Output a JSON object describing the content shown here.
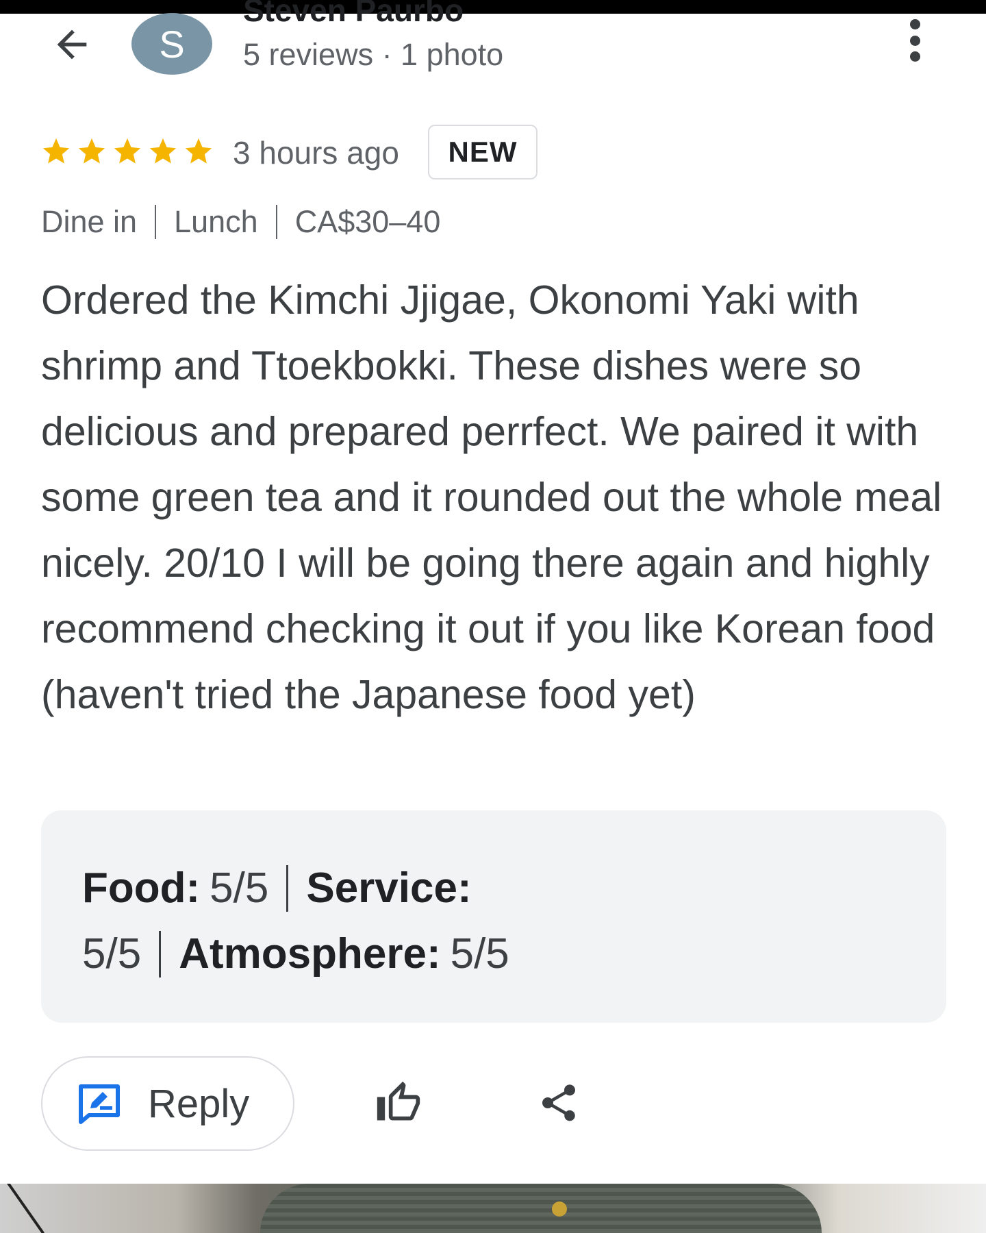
{
  "header": {
    "reviewer_name": "Steven Paurbo",
    "avatar_initial": "S",
    "meta": "5 reviews · 1 photo"
  },
  "review": {
    "rating": 5,
    "rating_max": 5,
    "time": "3 hours ago",
    "badge": "NEW",
    "tags": [
      "Dine in",
      "Lunch",
      "CA$30–40"
    ],
    "text": "Ordered the Kimchi Jjigae, Okonomi Yaki with shrimp and Ttoekbokki. These dishes were so delicious and prepared perrfect. We paired it with some green tea and it rounded out the whole meal nicely. 20/10 I will be going there again and highly recommend checking it out if you like Korean food (haven't tried the Japanese food yet)"
  },
  "subratings": {
    "food_label": "Food:",
    "food_value": "5/5",
    "service_label": "Service:",
    "service_value": "5/5",
    "atmosphere_label": "Atmosphere:",
    "atmosphere_value": "5/5"
  },
  "actions": {
    "reply_label": "Reply"
  },
  "icons": {
    "back": "arrow-back-icon",
    "more": "more-vert-icon",
    "star": "star-icon",
    "reply": "reply-edit-icon",
    "like": "thumb-up-icon",
    "share": "share-icon"
  },
  "colors": {
    "star": "#f4b400",
    "reply_icon": "#1a73e8",
    "avatar_bg": "#7a96a6",
    "subrating_bg": "#f1f3f4"
  }
}
